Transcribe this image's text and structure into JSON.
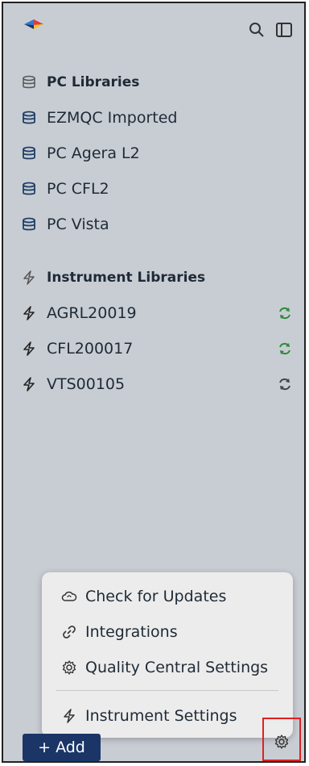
{
  "toolbar": {
    "search_icon": "search-icon",
    "panel_icon": "sidebar-panel-icon"
  },
  "pc_libraries": {
    "header": "PC Libraries",
    "items": [
      {
        "label": "EZMQC Imported"
      },
      {
        "label": "PC Agera L2"
      },
      {
        "label": "PC CFL2"
      },
      {
        "label": "PC Vista"
      }
    ]
  },
  "instrument_libraries": {
    "header": "Instrument Libraries",
    "items": [
      {
        "label": "AGRL20019",
        "sync_color": "#2e8b3a"
      },
      {
        "label": "CFL200017",
        "sync_color": "#2e8b3a"
      },
      {
        "label": "VTS00105",
        "sync_color": "#444444"
      }
    ]
  },
  "menu": {
    "items": [
      {
        "label": "Check for Updates",
        "icon": "cloud-sync-icon"
      },
      {
        "label": "Integrations",
        "icon": "link-icon"
      },
      {
        "label": "Quality Central Settings",
        "icon": "gear-icon"
      },
      {
        "label": "Instrument Settings",
        "icon": "lightning-icon"
      }
    ]
  },
  "footer": {
    "add_label": "+ Add",
    "settings_icon": "gear-icon"
  },
  "colors": {
    "sidebar_bg": "#c8cdd3",
    "add_button_bg": "#1b3566",
    "highlight_box": "#e02020",
    "sync_green": "#2e8b3a"
  }
}
